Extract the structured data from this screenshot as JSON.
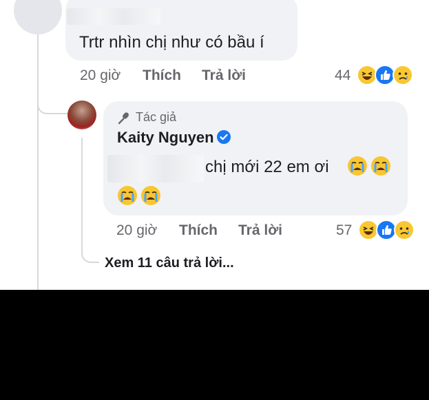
{
  "comment": {
    "text": "Trtr nhìn chị như có bầu í",
    "time": "20 giờ",
    "like_label": "Thích",
    "reply_label": "Trả lời",
    "reaction_count": "44",
    "reactions": [
      "haha-icon",
      "like-icon",
      "sad-icon"
    ]
  },
  "reply": {
    "badge": "Tác giả",
    "author": "Kaity Nguyen",
    "text": "chị mới 22 em ơi",
    "emoji_line": [
      "crying-icon",
      "crying-icon"
    ],
    "inline_emoji": [
      "crying-icon",
      "crying-icon"
    ],
    "time": "20 giờ",
    "like_label": "Thích",
    "reply_label": "Trả lời",
    "reaction_count": "57",
    "reactions": [
      "haha-icon",
      "like-icon",
      "sad-icon"
    ]
  },
  "view_more": "Xem 11 câu trả lời...",
  "colors": {
    "bubble": "#f0f2f5",
    "text": "#1c1e21",
    "meta": "#65676b",
    "like_blue": "#1877f2",
    "emoji_yellow": "#f8c832"
  }
}
